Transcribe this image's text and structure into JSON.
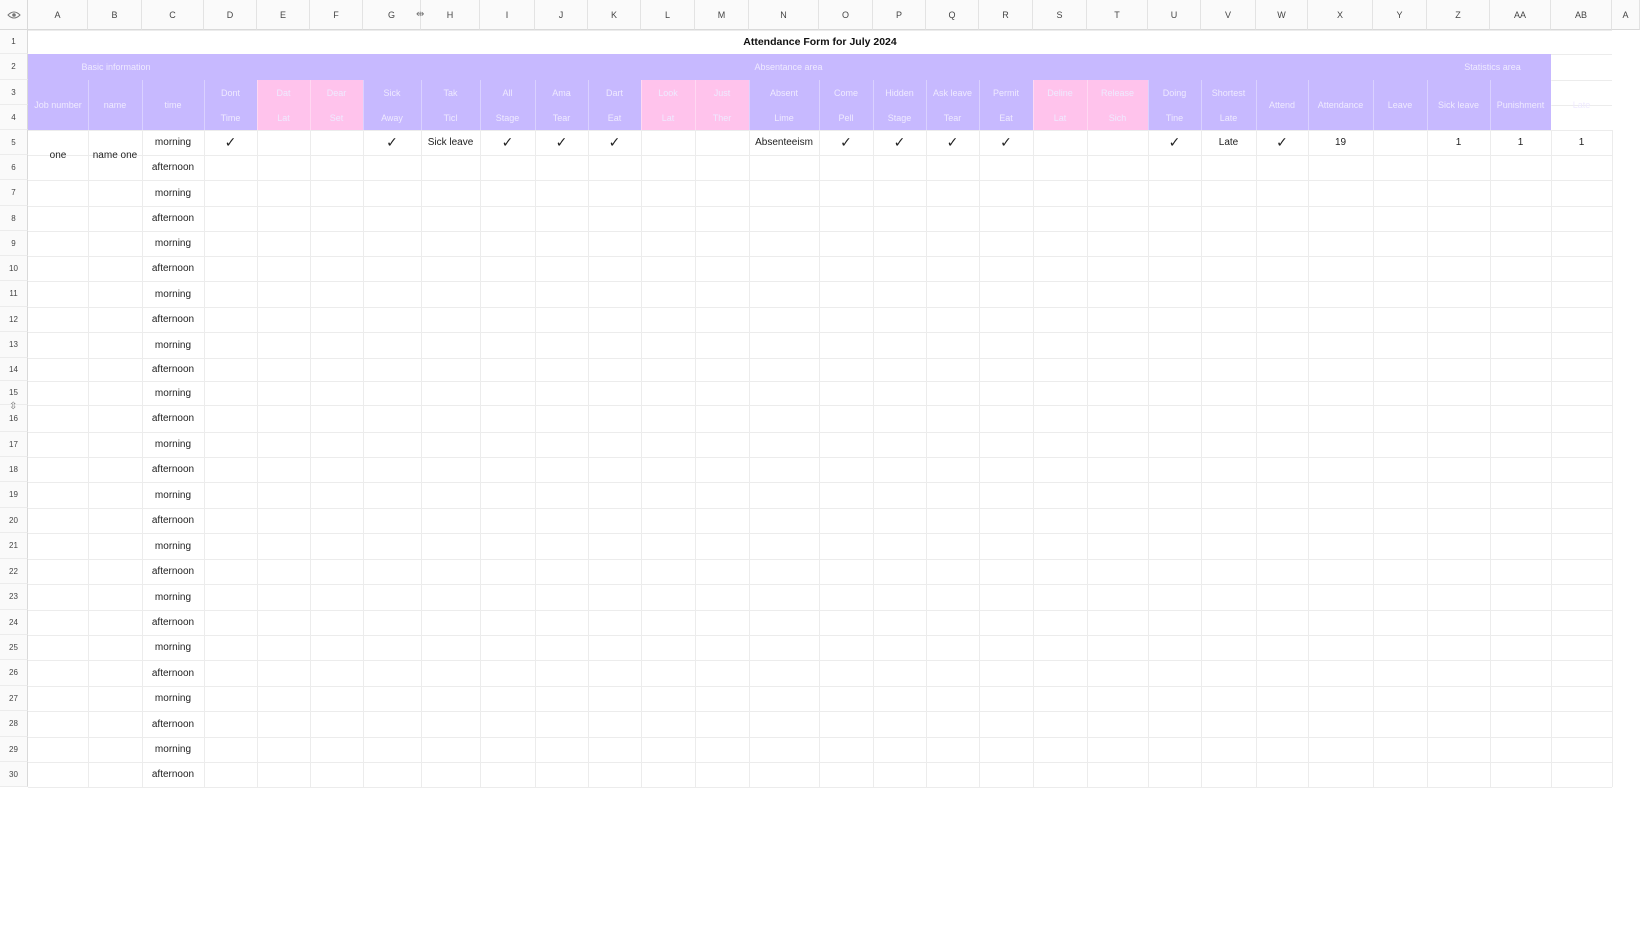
{
  "columns": [
    "A",
    "B",
    "C",
    "D",
    "E",
    "F",
    "G",
    "H",
    "I",
    "J",
    "K",
    "L",
    "M",
    "N",
    "O",
    "P",
    "Q",
    "R",
    "S",
    "T",
    "U",
    "V",
    "W",
    "X",
    "Y",
    "Z",
    "AA",
    "AB",
    "A"
  ],
  "row_numbers": [
    "1",
    "2",
    "3",
    "4",
    "5",
    "6",
    "7",
    "8",
    "9",
    "10",
    "11",
    "12",
    "13",
    "14",
    "15",
    "16",
    "17",
    "18",
    "19",
    "20",
    "21",
    "22",
    "23",
    "24",
    "25",
    "26",
    "27",
    "28",
    "29",
    "30"
  ],
  "title": "Attendance Form for July 2024",
  "colors": {
    "purple": "#c7b9ff",
    "pink": "#ffc3ec",
    "grid": "#ececec"
  },
  "header_groups": {
    "basic": "Basic information",
    "absence": "Absentance area",
    "statistics": "Statistics area"
  },
  "header_row3": [
    "Job number",
    "name",
    "time",
    "Dont",
    "Dat",
    "Dear",
    "Sick",
    "Tak",
    "All",
    "Ama",
    "Dart",
    "Look",
    "Just",
    "Absent",
    "Come",
    "Hidden",
    "Ask leave",
    "Permit",
    "Deline",
    "Release",
    "Doing",
    "Shortest",
    "Attend",
    "Attendance",
    "Leave",
    "Sick leave",
    "Punishment",
    "Late"
  ],
  "header_row4": [
    "",
    "",
    "",
    "Time",
    "Lat",
    "Set",
    "Away",
    "Ticl",
    "Stage",
    "Tear",
    "Eat",
    "Lat",
    "Ther",
    "Lime",
    "Pell",
    "Stage",
    "Tear",
    "Eat",
    "Lat",
    "Sich",
    "Tine",
    "Late",
    "Stad",
    "",
    "",
    "",
    "",
    ""
  ],
  "record": {
    "job_number": "one",
    "name": "name one",
    "sick_leave": "Sick leave",
    "absenteeism": "Absenteeism",
    "late": "Late",
    "attendance": "19",
    "sick_leave_count": "1",
    "punishment": "1",
    "late_count": "1"
  },
  "shifts": [
    "morning",
    "afternoon"
  ],
  "check_glyph": "✓",
  "icons": {
    "corner": "eye-icon",
    "column_resize": "column-resize-icon",
    "row_resize": "row-resize-icon"
  }
}
